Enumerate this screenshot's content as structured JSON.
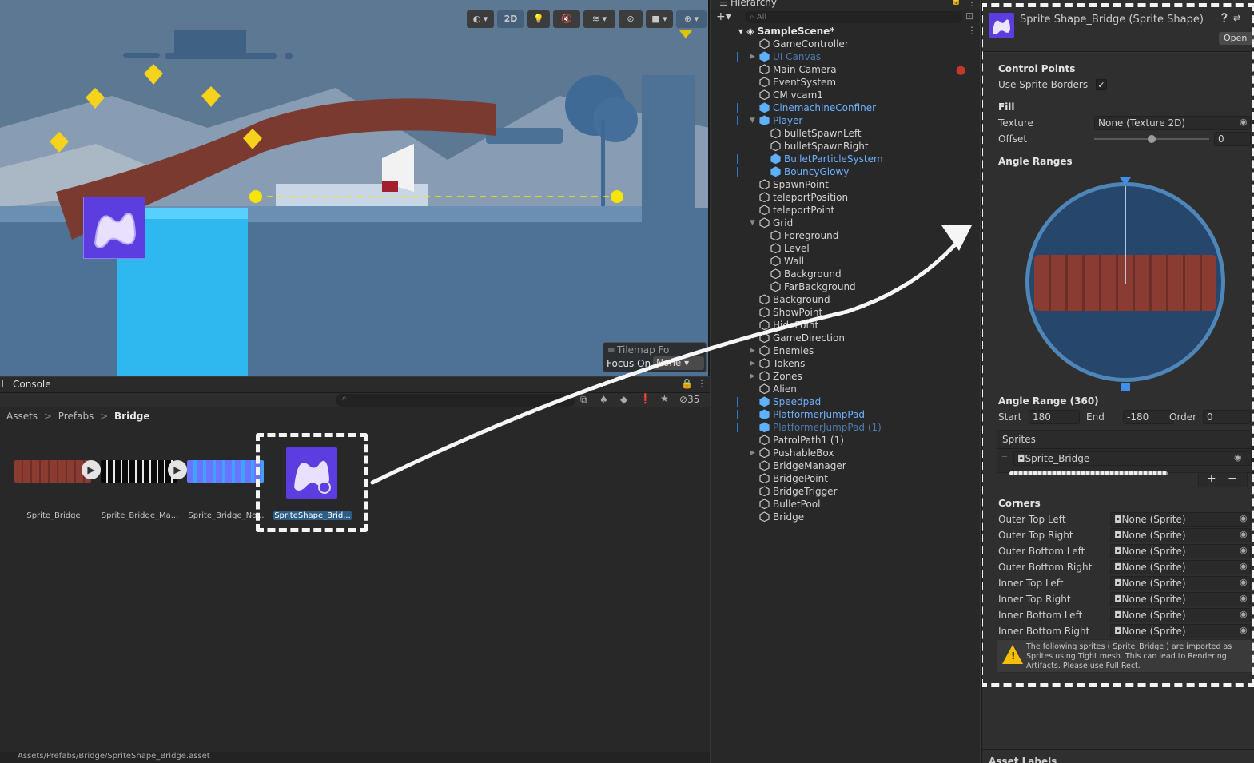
{
  "scene_toolbar": {
    "mode_2d": "2D",
    "gizmo_icons": [
      "shading-mode-icon",
      "light-icon",
      "audio-mute-icon",
      "effects-icon",
      "visibility-icon",
      "camera-icon",
      "gizmos-icon"
    ]
  },
  "tilemap_overlay": {
    "title": "Tilemap Fo",
    "focus_label": "Focus On",
    "focus_value": "None"
  },
  "console": {
    "tab": "Console",
    "search_placeholder": "",
    "count": "35"
  },
  "breadcrumb": {
    "a": "Assets",
    "b": "Prefabs",
    "c": "Bridge",
    "sep": ">"
  },
  "assets": [
    {
      "name": "Sprite_Bridge"
    },
    {
      "name": "Sprite_Bridge_Ma..."
    },
    {
      "name": "Sprite_Bridge_No..."
    },
    {
      "name": "SpriteShape_Brid..."
    }
  ],
  "status_bar": {
    "path": "Assets/Prefabs/Bridge/SpriteShape_Bridge.asset"
  },
  "hierarchy": {
    "tab": "Hierarchy",
    "search_placeholder": "All",
    "scene": "SampleScene*",
    "items": [
      {
        "label": "GameController",
        "indent": 0,
        "style": "normal",
        "fold": ""
      },
      {
        "label": "UI Canvas",
        "indent": 0,
        "style": "dim",
        "fold": "right"
      },
      {
        "label": "Main Camera",
        "indent": 0,
        "style": "normal",
        "fold": ""
      },
      {
        "label": "EventSystem",
        "indent": 0,
        "style": "normal",
        "fold": ""
      },
      {
        "label": "CM vcam1",
        "indent": 0,
        "style": "normal",
        "fold": ""
      },
      {
        "label": "CinemachineConfiner",
        "indent": 0,
        "style": "blue",
        "fold": ""
      },
      {
        "label": "Player",
        "indent": 0,
        "style": "blue",
        "fold": "down"
      },
      {
        "label": "bulletSpawnLeft",
        "indent": 1,
        "style": "normal",
        "fold": ""
      },
      {
        "label": "bulletSpawnRight",
        "indent": 1,
        "style": "normal",
        "fold": ""
      },
      {
        "label": "BulletParticleSystem",
        "indent": 1,
        "style": "blue",
        "fold": ""
      },
      {
        "label": "BouncyGlowy",
        "indent": 1,
        "style": "blue",
        "fold": ""
      },
      {
        "label": "SpawnPoint",
        "indent": 0,
        "style": "normal",
        "fold": ""
      },
      {
        "label": "teleportPosition",
        "indent": 0,
        "style": "normal",
        "fold": ""
      },
      {
        "label": "teleportPoint",
        "indent": 0,
        "style": "normal",
        "fold": ""
      },
      {
        "label": "Grid",
        "indent": 0,
        "style": "normal",
        "fold": "down"
      },
      {
        "label": "Foreground",
        "indent": 1,
        "style": "normal",
        "fold": ""
      },
      {
        "label": "Level",
        "indent": 1,
        "style": "normal",
        "fold": ""
      },
      {
        "label": "Wall",
        "indent": 1,
        "style": "normal",
        "fold": ""
      },
      {
        "label": "Background",
        "indent": 1,
        "style": "normal",
        "fold": ""
      },
      {
        "label": "FarBackground",
        "indent": 1,
        "style": "normal",
        "fold": ""
      },
      {
        "label": "Background",
        "indent": 0,
        "style": "normal",
        "fold": ""
      },
      {
        "label": "ShowPoint",
        "indent": 0,
        "style": "normal",
        "fold": ""
      },
      {
        "label": "HidePoint",
        "indent": 0,
        "style": "normal",
        "fold": ""
      },
      {
        "label": "GameDirection",
        "indent": 0,
        "style": "normal",
        "fold": ""
      },
      {
        "label": "Enemies",
        "indent": 0,
        "style": "normal",
        "fold": "right"
      },
      {
        "label": "Tokens",
        "indent": 0,
        "style": "normal",
        "fold": "right"
      },
      {
        "label": "Zones",
        "indent": 0,
        "style": "normal",
        "fold": "right"
      },
      {
        "label": "Alien",
        "indent": 0,
        "style": "normal",
        "fold": ""
      },
      {
        "label": "Speedpad",
        "indent": 0,
        "style": "blue",
        "fold": ""
      },
      {
        "label": "PlatformerJumpPad",
        "indent": 0,
        "style": "blue",
        "fold": ""
      },
      {
        "label": "PlatformerJumpPad (1)",
        "indent": 0,
        "style": "dim",
        "fold": ""
      },
      {
        "label": "PatrolPath1 (1)",
        "indent": 0,
        "style": "normal",
        "fold": ""
      },
      {
        "label": "PushableBox",
        "indent": 0,
        "style": "normal",
        "fold": "right"
      },
      {
        "label": "BridgeManager",
        "indent": 0,
        "style": "normal",
        "fold": ""
      },
      {
        "label": "BridgePoint",
        "indent": 0,
        "style": "normal",
        "fold": ""
      },
      {
        "label": "BridgeTrigger",
        "indent": 0,
        "style": "normal",
        "fold": ""
      },
      {
        "label": "BulletPool",
        "indent": 0,
        "style": "normal",
        "fold": ""
      },
      {
        "label": "Bridge",
        "indent": 0,
        "style": "normal",
        "fold": ""
      }
    ]
  },
  "inspector": {
    "title": "Sprite Shape_Bridge (Sprite Shape)",
    "open_button": "Open",
    "control_points_header": "Control Points",
    "use_sprite_borders_label": "Use Sprite Borders",
    "use_sprite_borders_check": "✓",
    "fill_header": "Fill",
    "texture_label": "Texture",
    "texture_value": "None (Texture 2D)",
    "offset_label": "Offset",
    "offset_value": "0",
    "offset_slider": 0.5,
    "angle_ranges_header": "Angle Ranges",
    "angle_range_header": "Angle Range (360)",
    "start_label": "Start",
    "start_value": "180",
    "end_label": "End",
    "end_value": "-180",
    "order_label": "Order",
    "order_value": "0",
    "sprites_header": "Sprites",
    "sprite_value": "Sprite_Bridge",
    "plus": "+",
    "minus": "−",
    "corners_header": "Corners",
    "corners": [
      {
        "label": "Outer Top Left",
        "value": "None (Sprite)"
      },
      {
        "label": "Outer Top Right",
        "value": "None (Sprite)"
      },
      {
        "label": "Outer Bottom Left",
        "value": "None (Sprite)"
      },
      {
        "label": "Outer Bottom Right",
        "value": "None (Sprite)"
      },
      {
        "label": "Inner Top Left",
        "value": "None (Sprite)"
      },
      {
        "label": "Inner Top Right",
        "value": "None (Sprite)"
      },
      {
        "label": "Inner Bottom Left",
        "value": "None (Sprite)"
      },
      {
        "label": "Inner Bottom Right",
        "value": "None (Sprite)"
      }
    ],
    "warning": "The following sprites ( Sprite_Bridge ) are imported as Sprites using Tight mesh. This can lead to Rendering Artifacts. Please use Full Rect.",
    "asset_labels": "Asset Labels"
  },
  "colors": {
    "accent": "#4b7bd8",
    "sprite_purple": "#5b3de0",
    "bridge_wood": "#7b3a2f",
    "water": "#2fb8f0",
    "sky": "#5d7892"
  }
}
